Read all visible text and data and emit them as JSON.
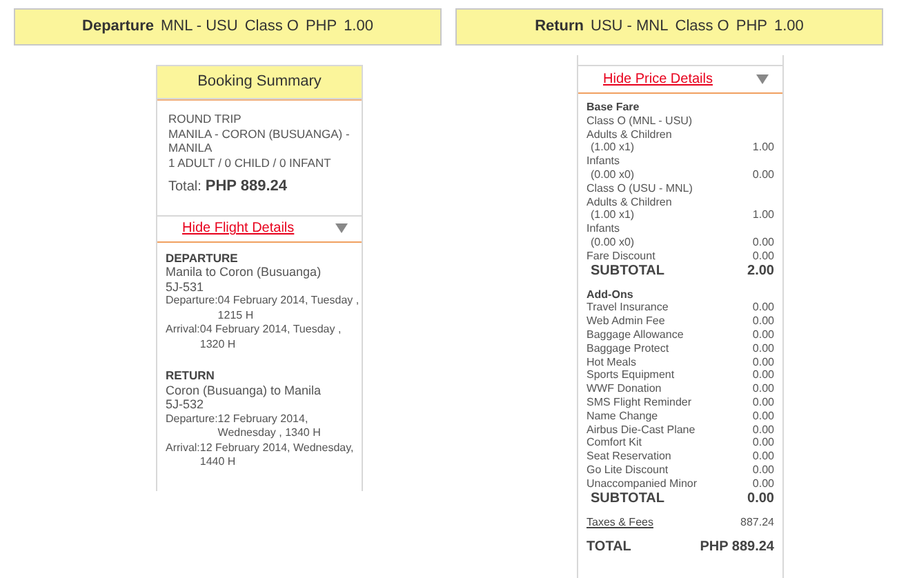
{
  "fare_headers": [
    {
      "label": "Departure",
      "route": "MNL - USU",
      "fare_class": "Class O",
      "currency": "PHP",
      "amount": "1.00"
    },
    {
      "label": "Return",
      "route": "USU - MNL",
      "fare_class": "Class O",
      "currency": "PHP",
      "amount": "1.00"
    }
  ],
  "booking_summary": {
    "title": "Booking Summary",
    "lines": [
      "ROUND TRIP",
      "MANILA - CORON (BUSUANGA) - MANILA",
      "1 ADULT / 0 CHILD / 0 INFANT"
    ],
    "total_label": "Total:",
    "total_value": "PHP 889.24",
    "toggle": "Hide Flight Details",
    "flights": [
      {
        "heading": "DEPARTURE",
        "route": "Manila to Coron (Busuanga) 5J-531",
        "times": [
          {
            "label": "Departure:",
            "value": "04 February 2014, Tuesday , 1215 H"
          },
          {
            "label": "Arrival:",
            "value": "04 February 2014, Tuesday , 1320 H"
          }
        ]
      },
      {
        "heading": "RETURN",
        "route": "Coron (Busuanga) to Manila 5J-532",
        "times": [
          {
            "label": "Departure:",
            "value": "12 February 2014, Wednesday , 1340 H"
          },
          {
            "label": "Arrival:",
            "value": "12 February 2014, Wednesday, 1440 H"
          }
        ]
      }
    ]
  },
  "price_details": {
    "toggle": "Hide Price Details",
    "rows": [
      {
        "kind": "heading",
        "label": "Base Fare"
      },
      {
        "kind": "item",
        "label": "Class O (MNL - USU)"
      },
      {
        "kind": "item",
        "label": "Adults & Children"
      },
      {
        "kind": "sub",
        "label": "(1.00 x1)",
        "amount": "1.00"
      },
      {
        "kind": "item",
        "label": "Infants"
      },
      {
        "kind": "sub",
        "label": "(0.00 x0)",
        "amount": "0.00"
      },
      {
        "kind": "item",
        "label": "Class O (USU - MNL)"
      },
      {
        "kind": "item",
        "label": "Adults & Children"
      },
      {
        "kind": "sub",
        "label": "(1.00 x1)",
        "amount": "1.00"
      },
      {
        "kind": "item",
        "label": "Infants"
      },
      {
        "kind": "sub",
        "label": "(0.00 x0)",
        "amount": "0.00"
      },
      {
        "kind": "item",
        "label": "Fare Discount",
        "amount": "0.00"
      },
      {
        "kind": "subtotal",
        "label": "SUBTOTAL",
        "amount": "2.00"
      },
      {
        "kind": "heading",
        "label": "Add-Ons"
      },
      {
        "kind": "item",
        "label": "Travel Insurance",
        "amount": "0.00"
      },
      {
        "kind": "item",
        "label": "Web Admin Fee",
        "amount": "0.00"
      },
      {
        "kind": "item",
        "label": "Baggage Allowance",
        "amount": "0.00"
      },
      {
        "kind": "item",
        "label": "Baggage Protect",
        "amount": "0.00"
      },
      {
        "kind": "item",
        "label": "Hot Meals",
        "amount": "0.00"
      },
      {
        "kind": "item",
        "label": "Sports Equipment",
        "amount": "0.00"
      },
      {
        "kind": "item",
        "label": "WWF Donation",
        "amount": "0.00"
      },
      {
        "kind": "item",
        "label": "SMS Flight Reminder",
        "amount": "0.00"
      },
      {
        "kind": "item",
        "label": "Name Change",
        "amount": "0.00"
      },
      {
        "kind": "item",
        "label": "Airbus Die-Cast Plane",
        "amount": "0.00"
      },
      {
        "kind": "item",
        "label": "Comfort Kit",
        "amount": "0.00"
      },
      {
        "kind": "item",
        "label": "Seat Reservation",
        "amount": "0.00"
      },
      {
        "kind": "item",
        "label": "Go Lite Discount",
        "amount": "0.00"
      },
      {
        "kind": "item",
        "label": "Unaccompanied Minor",
        "amount": "0.00"
      },
      {
        "kind": "subtotal",
        "label": "SUBTOTAL",
        "amount": "0.00"
      },
      {
        "kind": "link",
        "label": "Taxes & Fees",
        "amount": "887.24"
      },
      {
        "kind": "total",
        "label": "TOTAL",
        "amount": "PHP 889.24"
      }
    ]
  }
}
